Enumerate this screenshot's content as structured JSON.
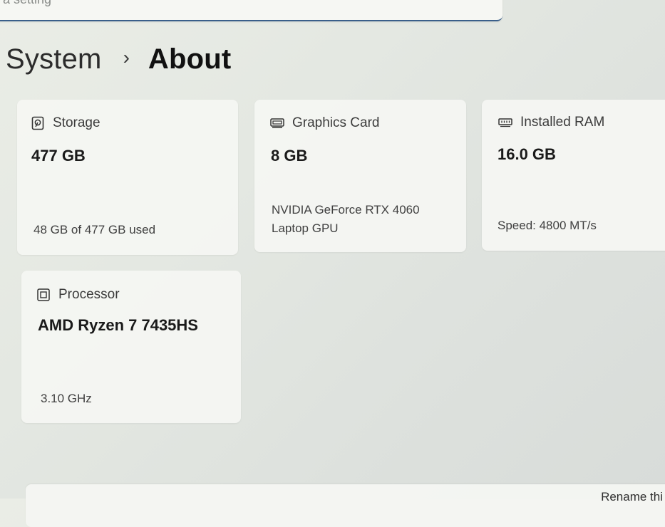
{
  "search": {
    "placeholder": "a setting"
  },
  "breadcrumb": {
    "parent": "System",
    "separator": "›",
    "current": "About"
  },
  "cards": {
    "storage": {
      "title": "Storage",
      "icon": "storage-icon",
      "value": "477 GB",
      "detail": "48 GB of 477 GB used"
    },
    "graphics": {
      "title": "Graphics Card",
      "icon": "graphics-card-icon",
      "value": "8 GB",
      "detail_line1": "NVIDIA GeForce RTX 4060",
      "detail_line2": "Laptop GPU"
    },
    "ram": {
      "title": "Installed RAM",
      "icon": "ram-icon",
      "value": "16.0 GB",
      "detail": "Speed: 4800 MT/s"
    },
    "processor": {
      "title": "Processor",
      "icon": "processor-icon",
      "value": "AMD Ryzen 7 7435HS",
      "detail": "3.10 GHz"
    }
  },
  "footer": {
    "rename_label": "Rename thi"
  },
  "colors": {
    "accent_underline": "#3a5f8a",
    "card_bg": "#f5f6f3",
    "page_bg": "#e4e8e2"
  }
}
